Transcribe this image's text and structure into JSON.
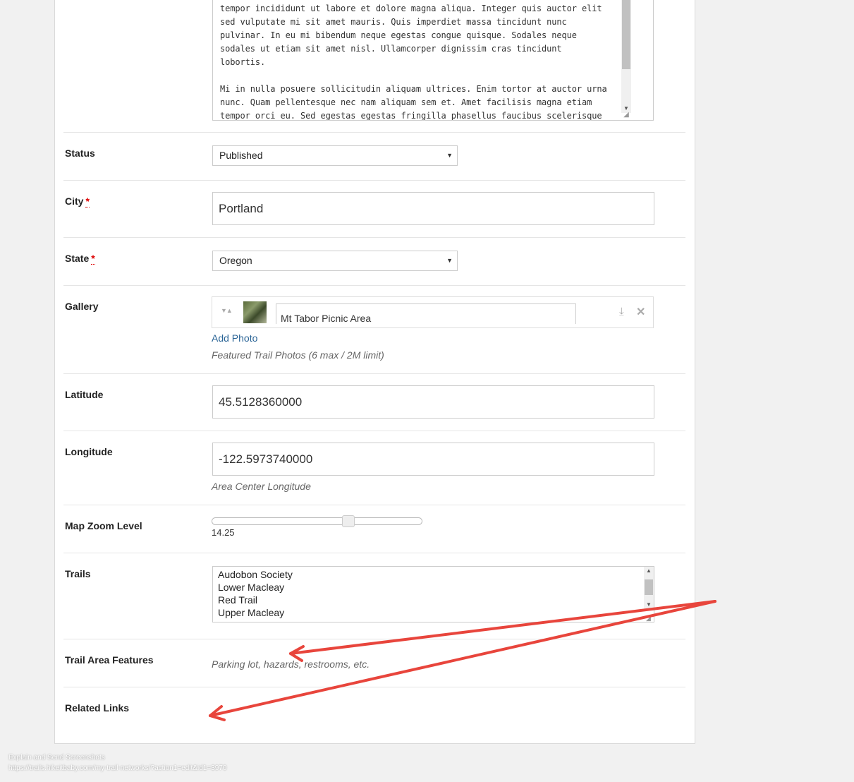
{
  "body_text": "tempor incididunt ut labore et dolore magna aliqua. Integer quis auctor elit sed vulputate mi sit amet mauris. Quis imperdiet massa tincidunt nunc pulvinar. In eu mi bibendum neque egestas congue quisque. Sodales neque sodales ut etiam sit amet nisl. Ullamcorper dignissim cras tincidunt lobortis.\n\nMi in nulla posuere sollicitudin aliquam ultrices. Enim tortor at auctor urna nunc. Quam pellentesque nec nam aliquam sem et. Amet facilisis magna etiam tempor orci eu. Sed egestas egestas fringilla phasellus faucibus scelerisque",
  "fields": {
    "status": {
      "label": "Status",
      "value": "Published"
    },
    "city": {
      "label": "City",
      "required_mark": "*",
      "value": "Portland"
    },
    "state": {
      "label": "State",
      "required_mark": "*",
      "value": "Oregon"
    },
    "gallery": {
      "label": "Gallery",
      "photo_caption": "Mt Tabor Picnic Area",
      "add_link": "Add Photo",
      "hint": "Featured Trail Photos (6 max / 2M limit)"
    },
    "latitude": {
      "label": "Latitude",
      "value": "45.5128360000"
    },
    "longitude": {
      "label": "Longitude",
      "value": "-122.5973740000",
      "hint": "Area Center Longitude"
    },
    "zoom": {
      "label": "Map Zoom Level",
      "value": "14.25",
      "level_fraction": 0.66
    },
    "trails": {
      "label": "Trails",
      "options": [
        "Audobon Society",
        "Lower Macleay",
        "Red Trail",
        "Upper Macleay"
      ]
    },
    "features": {
      "label": "Trail Area Features",
      "hint": "Parking lot, hazards, restrooms, etc."
    },
    "related": {
      "label": "Related Links"
    }
  },
  "footer": {
    "line1": "Explain and Send Screenshots",
    "line2": "https://trails.hikeitbaby.com/my-trail-networks/?action1=edit&id1=3970"
  },
  "annotation_color": "#e8453c"
}
